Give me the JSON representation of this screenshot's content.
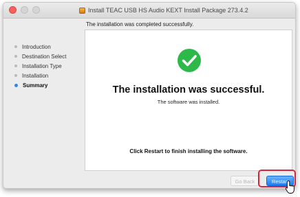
{
  "window": {
    "title": "Install TEAC USB HS Audio KEXT Install Package 273.4.2",
    "subheader": "The installation was completed successfully."
  },
  "sidebar": {
    "steps": [
      {
        "label": "Introduction",
        "active": false
      },
      {
        "label": "Destination Select",
        "active": false
      },
      {
        "label": "Installation Type",
        "active": false
      },
      {
        "label": "Installation",
        "active": false
      },
      {
        "label": "Summary",
        "active": true
      }
    ]
  },
  "main": {
    "icon": "checkmark-circle-icon",
    "headline": "The installation was successful.",
    "message": "The software was installed.",
    "instruction": "Click Restart to finish installing the software."
  },
  "buttons": {
    "go_back": "Go Back",
    "restart": "Restart"
  },
  "colors": {
    "success_green": "#2db84a",
    "accent_blue": "#1a7ef5",
    "highlight_red": "#d9253a"
  }
}
